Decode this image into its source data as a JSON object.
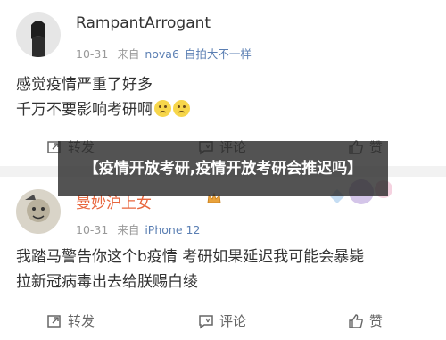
{
  "posts": [
    {
      "username": "RampantArrogant",
      "date": "10-31",
      "source_prefix": "来自",
      "source_device": "nova6",
      "source_suffix": "自拍大不一样",
      "text_line1": "感觉疫情严重了好多",
      "text_line2": "千万不要影响考研啊",
      "actions": {
        "repost": "转发",
        "comment": "评论",
        "like": "赞"
      }
    },
    {
      "username": "曼妙沪上女",
      "date": "10-31",
      "source_prefix": "来自",
      "source_device": "iPhone 12",
      "text_line1": "我踏马警告你这个b疫情 考研如果延迟我可能会暴毙",
      "text_line2": "拉新冠病毒出去给朕赐白绫",
      "actions": {
        "repost": "转发",
        "comment": "评论",
        "like": "赞"
      }
    }
  ],
  "overlay_title": "【疫情开放考研,疫情开放考研会推迟吗】",
  "colors": {
    "username_highlight": "#e8663d",
    "source_link": "#5b7fb3",
    "overlay_bg": "#282828"
  },
  "icons": [
    "repost-icon",
    "comment-icon",
    "like-icon",
    "crown-icon",
    "sad-emoji-icon"
  ]
}
